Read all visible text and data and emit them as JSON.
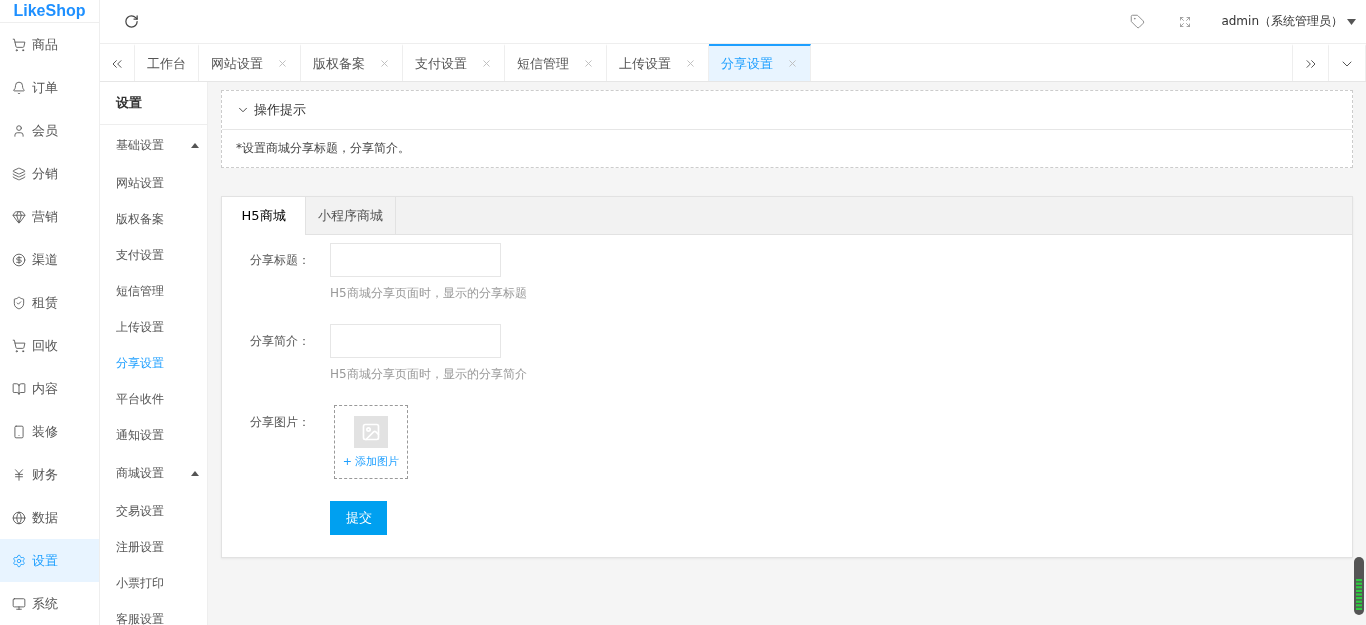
{
  "logo": "LikeShop",
  "header": {
    "user": "admin（系统管理员）"
  },
  "sidebar": {
    "items": [
      {
        "label": "商品",
        "selected": false
      },
      {
        "label": "订单",
        "selected": false
      },
      {
        "label": "会员",
        "selected": false
      },
      {
        "label": "分销",
        "selected": false
      },
      {
        "label": "营销",
        "selected": false
      },
      {
        "label": "渠道",
        "selected": false
      },
      {
        "label": "租赁",
        "selected": false
      },
      {
        "label": "回收",
        "selected": false
      },
      {
        "label": "内容",
        "selected": false
      },
      {
        "label": "装修",
        "selected": false
      },
      {
        "label": "财务",
        "selected": false
      },
      {
        "label": "数据",
        "selected": false
      },
      {
        "label": "设置",
        "selected": true
      },
      {
        "label": "系统",
        "selected": false
      }
    ]
  },
  "page_tabs": [
    {
      "label": "工作台",
      "selected": false,
      "closable": false
    },
    {
      "label": "网站设置",
      "selected": false,
      "closable": true
    },
    {
      "label": "版权备案",
      "selected": false,
      "closable": true
    },
    {
      "label": "支付设置",
      "selected": false,
      "closable": true
    },
    {
      "label": "短信管理",
      "selected": false,
      "closable": true
    },
    {
      "label": "上传设置",
      "selected": false,
      "closable": true
    },
    {
      "label": "分享设置",
      "selected": true,
      "closable": true
    }
  ],
  "subnav": {
    "title": "设置",
    "groups": [
      {
        "label": "基础设置",
        "expanded": true,
        "children": [
          {
            "label": "网站设置",
            "selected": false
          },
          {
            "label": "版权备案",
            "selected": false
          },
          {
            "label": "支付设置",
            "selected": false
          },
          {
            "label": "短信管理",
            "selected": false
          },
          {
            "label": "上传设置",
            "selected": false
          },
          {
            "label": "分享设置",
            "selected": true
          },
          {
            "label": "平台收件",
            "selected": false
          },
          {
            "label": "通知设置",
            "selected": false
          }
        ]
      },
      {
        "label": "商城设置",
        "expanded": true,
        "children": [
          {
            "label": "交易设置",
            "selected": false
          },
          {
            "label": "注册设置",
            "selected": false
          },
          {
            "label": "小票打印",
            "selected": false
          },
          {
            "label": "客服设置",
            "selected": false
          }
        ]
      }
    ]
  },
  "tips": {
    "title": "操作提示",
    "expanded": true,
    "text": "*设置商城分享标题，分享简介。"
  },
  "form_tabs": [
    {
      "label": "H5商城",
      "selected": true
    },
    {
      "label": "小程序商城",
      "selected": false
    }
  ],
  "form": {
    "fields": [
      {
        "kind": "text",
        "label": "分享标题：",
        "help": "H5商城分享页面时，显示的分享标题"
      },
      {
        "kind": "text",
        "label": "分享简介：",
        "help": "H5商城分享页面时，显示的分享简介"
      },
      {
        "kind": "image",
        "label": "分享图片：",
        "button": "+ 添加图片"
      }
    ],
    "submit": "提交"
  }
}
